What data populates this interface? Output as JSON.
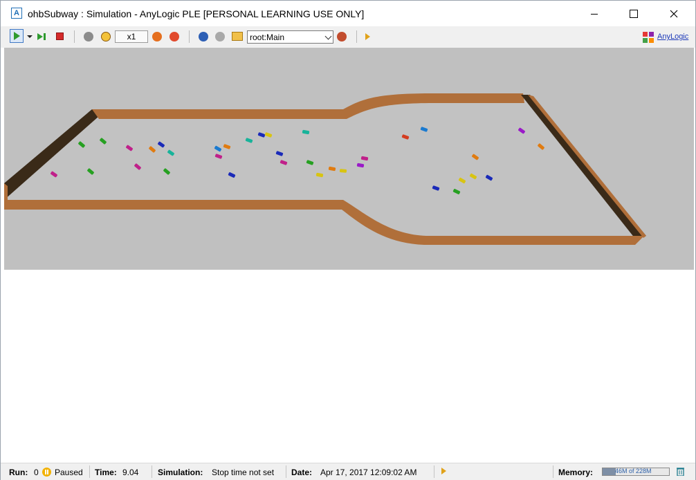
{
  "window": {
    "title": "ohbSubway : Simulation - AnyLogic PLE [PERSONAL LEARNING USE ONLY]",
    "app_icon_glyph": "A"
  },
  "toolbar": {
    "speed_label": "x1",
    "root_select": "root:Main",
    "brand_link": "AnyLogic",
    "icons": [
      "run-icon",
      "run-dropdown-icon",
      "step-icon",
      "stop-icon",
      "agent-icon",
      "clock-icon",
      "speed-down-icon",
      "speed-up-icon",
      "navigate-icon",
      "view-icon",
      "folder-icon",
      "camera-icon",
      "sim-log-icon",
      "anylogic-logo-icon"
    ]
  },
  "colors": {
    "wall": "#b06f3a",
    "wall_dark": "#3a2a18",
    "floor": "#c0c0c0",
    "accent": "#3f78c4"
  },
  "status": {
    "run_label": "Run:",
    "run_value": "0",
    "state": "Paused",
    "time_label": "Time:",
    "time_value": "9.04",
    "sim_label": "Simulation:",
    "sim_value": "Stop time not set",
    "date_label": "Date:",
    "date_value": "Apr 17, 2017 12:09:02 AM",
    "memory_label": "Memory:",
    "memory_value": "46M of 228M",
    "memory_fraction": 0.2
  }
}
